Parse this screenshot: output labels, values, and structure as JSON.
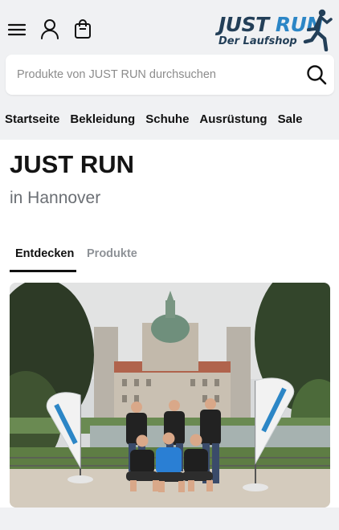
{
  "header": {
    "logo": {
      "brand_first": "JUST ",
      "brand_second": "RUN",
      "tagline": "Der Laufshop"
    },
    "icons": {
      "menu": "hamburger-menu-icon",
      "account": "user-account-icon",
      "cart": "shopping-bag-icon",
      "search": "search-icon"
    }
  },
  "search": {
    "placeholder": "Produkte von JUST RUN durchsuchen"
  },
  "nav": {
    "items": [
      {
        "label": "Startseite"
      },
      {
        "label": "Bekleidung"
      },
      {
        "label": "Schuhe"
      },
      {
        "label": "Ausrüstung"
      },
      {
        "label": "Sale"
      }
    ]
  },
  "store": {
    "name": "JUST RUN",
    "location": "in Hannover"
  },
  "tabs": {
    "discover": "Entdecken",
    "products": "Produkte",
    "active": "discover"
  },
  "colors": {
    "brand_dark": "#233f58",
    "brand_blue": "#2c86c6",
    "header_bg": "#f0f1f3"
  }
}
